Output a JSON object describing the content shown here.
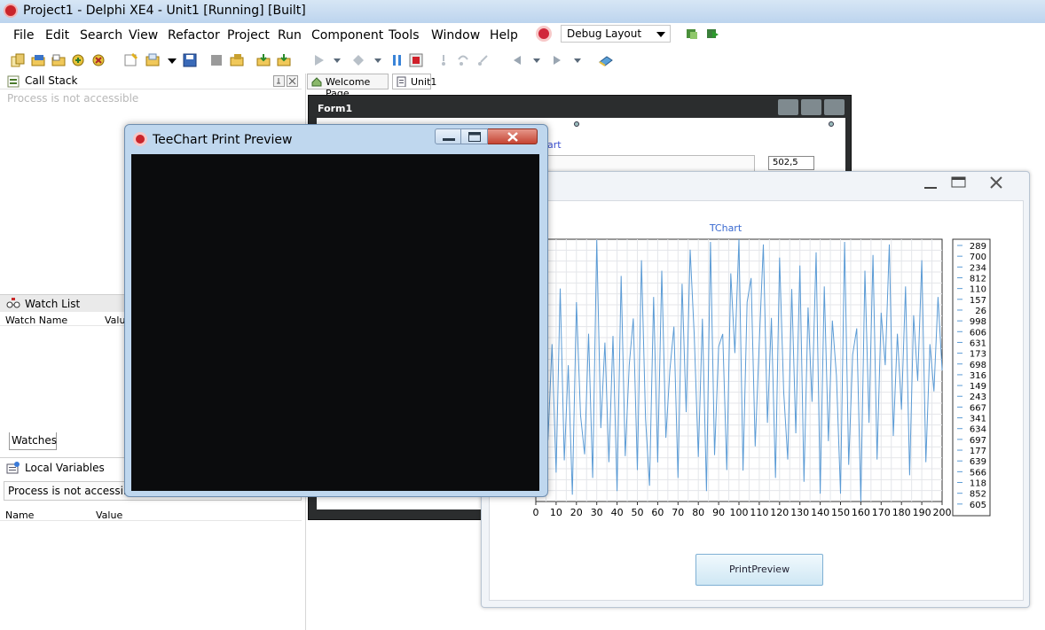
{
  "ide": {
    "window_title": "Project1 - Delphi XE4 - Unit1 [Running] [Built]",
    "menu": [
      "File",
      "Edit",
      "Search",
      "View",
      "Refactor",
      "Project",
      "Run",
      "Component",
      "Tools",
      "Window",
      "Help"
    ],
    "layout_combo": "Debug Layout"
  },
  "call_stack": {
    "title": "Call Stack",
    "message": "Process is not accessible"
  },
  "watch_list": {
    "title": "Watch List",
    "col_name": "Watch Name",
    "col_value": "Value",
    "tab": "Watches"
  },
  "local_variables": {
    "title": "Local Variables",
    "message": "Process is not accessible",
    "col_name": "Name",
    "col_value": "Value"
  },
  "editor_tabs": [
    "Welcome Page",
    "Unit1"
  ],
  "form_designer": {
    "title": "Form1",
    "chart_label": "art",
    "legend_value": "502,5"
  },
  "print_preview": {
    "title": "TeeChart Print Preview"
  },
  "running_form": {
    "button_label": "PrintPreview"
  },
  "chart_data": {
    "type": "line",
    "title": "TChart",
    "xlim": [
      0,
      200
    ],
    "x_ticks": [
      0,
      10,
      20,
      30,
      40,
      50,
      60,
      70,
      80,
      90,
      100,
      110,
      120,
      130,
      140,
      150,
      160,
      170,
      180,
      190,
      200
    ],
    "ylim": [
      0,
      1000
    ],
    "grid": true,
    "legend_position": "right",
    "legend_values": [
      "289",
      "700",
      "234",
      "812",
      "110",
      "157",
      "26",
      "998",
      "606",
      "631",
      "173",
      "698",
      "316",
      "149",
      "243",
      "667",
      "341",
      "634",
      "697",
      "177",
      "639",
      "566",
      "118",
      "852",
      "605"
    ],
    "series": [
      {
        "color": "#5b9bd5",
        "x": [
          0,
          2,
          4,
          6,
          8,
          10,
          12,
          14,
          16,
          18,
          20,
          22,
          24,
          26,
          28,
          30,
          32,
          34,
          36,
          38,
          40,
          42,
          44,
          46,
          48,
          50,
          52,
          54,
          56,
          58,
          60,
          62,
          64,
          66,
          68,
          70,
          72,
          74,
          76,
          78,
          80,
          82,
          84,
          86,
          88,
          90,
          92,
          94,
          96,
          98,
          100,
          102,
          104,
          106,
          108,
          110,
          112,
          114,
          116,
          118,
          120,
          122,
          124,
          126,
          128,
          130,
          132,
          134,
          136,
          138,
          140,
          142,
          144,
          146,
          148,
          150,
          152,
          154,
          156,
          158,
          160,
          162,
          164,
          166,
          168,
          170,
          172,
          174,
          176,
          178,
          180,
          182,
          184,
          186,
          188,
          190,
          192,
          194,
          196,
          198,
          200
        ],
        "y": [
          700,
          289,
          650,
          234,
          600,
          110,
          812,
          157,
          520,
          26,
          760,
          330,
          180,
          640,
          90,
          998,
          280,
          606,
          150,
          631,
          40,
          860,
          173,
          520,
          698,
          120,
          920,
          316,
          60,
          780,
          149,
          880,
          243,
          500,
          667,
          90,
          830,
          341,
          960,
          634,
          170,
          697,
          40,
          990,
          177,
          590,
          639,
          120,
          870,
          566,
          1000,
          118,
          760,
          852,
          210,
          605,
          980,
          300,
          700,
          90,
          930,
          420,
          160,
          810,
          260,
          900,
          75,
          740,
          380,
          950,
          30,
          820,
          230,
          690,
          480,
          30,
          990,
          140,
          560,
          660,
          0,
          880,
          300,
          940,
          160,
          720,
          520,
          980,
          250,
          640,
          350,
          820,
          100,
          710,
          460,
          920,
          150,
          600,
          420,
          780,
          500
        ]
      }
    ]
  }
}
